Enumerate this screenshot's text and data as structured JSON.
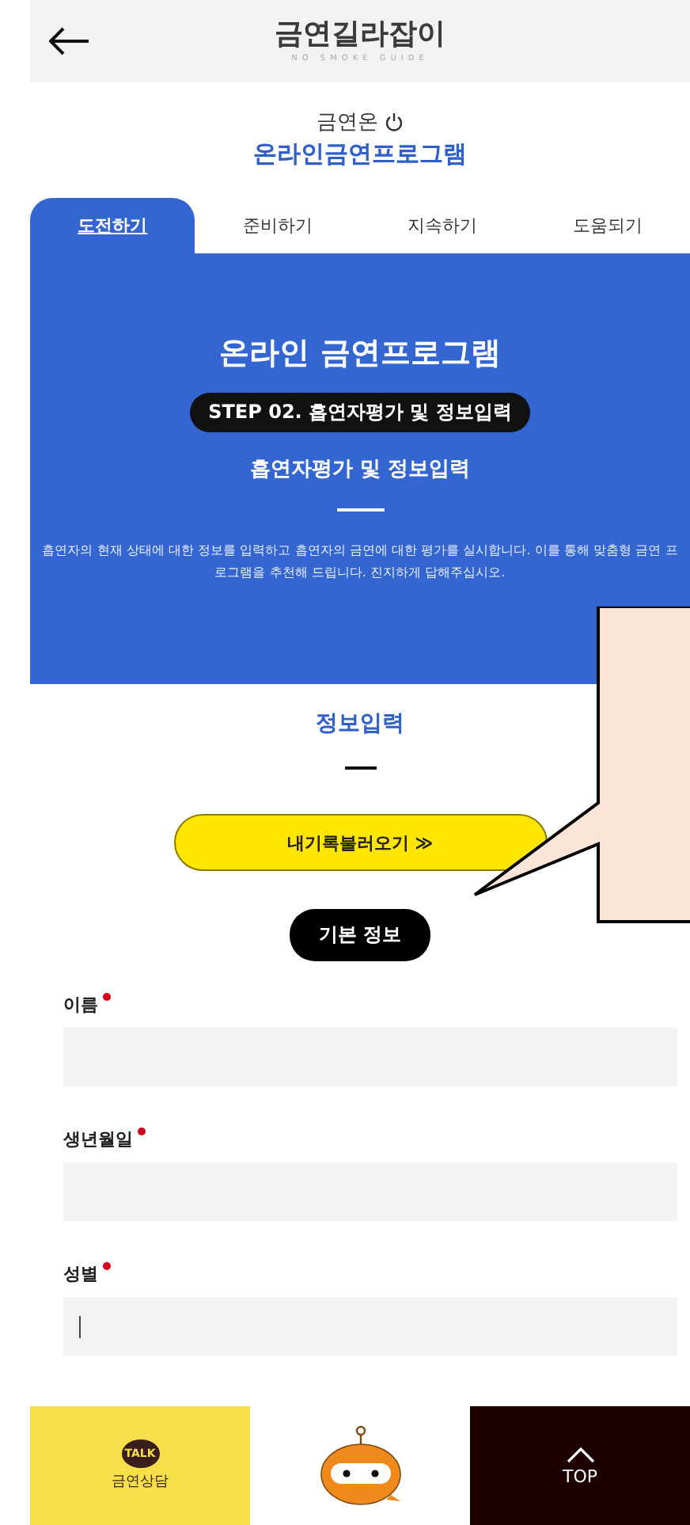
{
  "header": {
    "logo_text": "금연길라잡이",
    "logo_sub": "NO SMOKE GUIDE"
  },
  "intro": {
    "overline": "금연온",
    "title": "온라인금연프로그램"
  },
  "tabs": [
    {
      "label": "도전하기",
      "selected": true
    },
    {
      "label": "준비하기",
      "selected": false
    },
    {
      "label": "지속하기",
      "selected": false
    },
    {
      "label": "도움되기",
      "selected": false
    }
  ],
  "banner": {
    "title": "온라인 금연프로그램",
    "step": "STEP 02. 흡연자평가 및 정보입력",
    "subtitle": "흡연자평가 및 정보입력",
    "description": "흡연자의 현재 상태에 대한 정보를 입력하고 흡연자의 금연에 대한 평가를 실시합니다. 이를 통해 맞춤형 금연 프로그램을 추천해 드립니다. 진지하게 답해주십시오."
  },
  "section": {
    "title": "정보입력",
    "load_button": "내기록불러오기 ≫",
    "group_label": "기본 정보"
  },
  "fields": [
    {
      "label": "이름",
      "required": true,
      "focused": false
    },
    {
      "label": "생년월일",
      "required": true,
      "focused": false
    },
    {
      "label": "성별",
      "required": true,
      "focused": true
    }
  ],
  "bottom_bar": {
    "chat_badge": "TALK",
    "chat_label": "금연상담",
    "top_label": "TOP"
  }
}
